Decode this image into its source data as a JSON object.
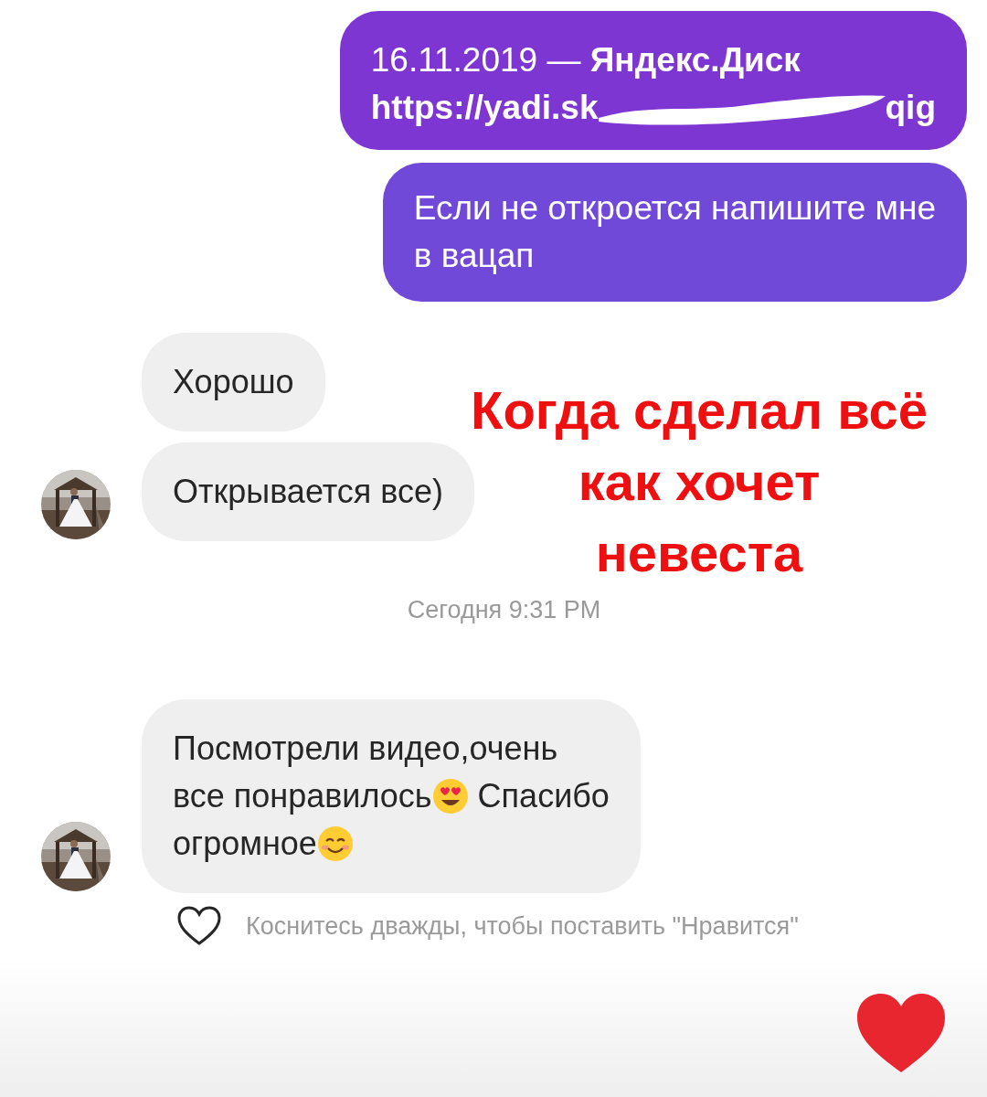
{
  "messages": [
    {
      "kind": "link",
      "text": "16.11.2019 — **Яндекс.Диск**",
      "url_start": "https://yadi.sk",
      "url_end": "qig"
    },
    {
      "kind": "outgoing",
      "text": "Если не откроется напишите мне\nв вацап"
    },
    {
      "kind": "incoming",
      "avatar": false,
      "lines": [
        [
          {
            "kind": "text",
            "text": "Хорошо"
          }
        ]
      ]
    },
    {
      "kind": "incoming",
      "avatar": true,
      "lines": [
        [
          {
            "kind": "text",
            "text": "Открывается все)"
          }
        ]
      ]
    },
    {
      "kind": "timestamp",
      "text": "Сегодня 9:31 PM"
    },
    {
      "kind": "incoming",
      "avatar": true,
      "lines": [
        [
          {
            "kind": "text",
            "text": "Посмотрели видео,очень"
          }
        ],
        [
          {
            "kind": "text",
            "text": "все понравилось"
          },
          {
            "kind": "hearteyes"
          },
          {
            "kind": "text",
            "text": " Спасибо"
          }
        ],
        [
          {
            "kind": "text",
            "text": "огромное"
          },
          {
            "kind": "smile"
          }
        ]
      ]
    },
    {
      "kind": "hint",
      "text": "Коснитесь дважды, чтобы поставить \"Нравится\""
    }
  ],
  "caption": "Когда сделал всё\nкак хочет\nневеста"
}
